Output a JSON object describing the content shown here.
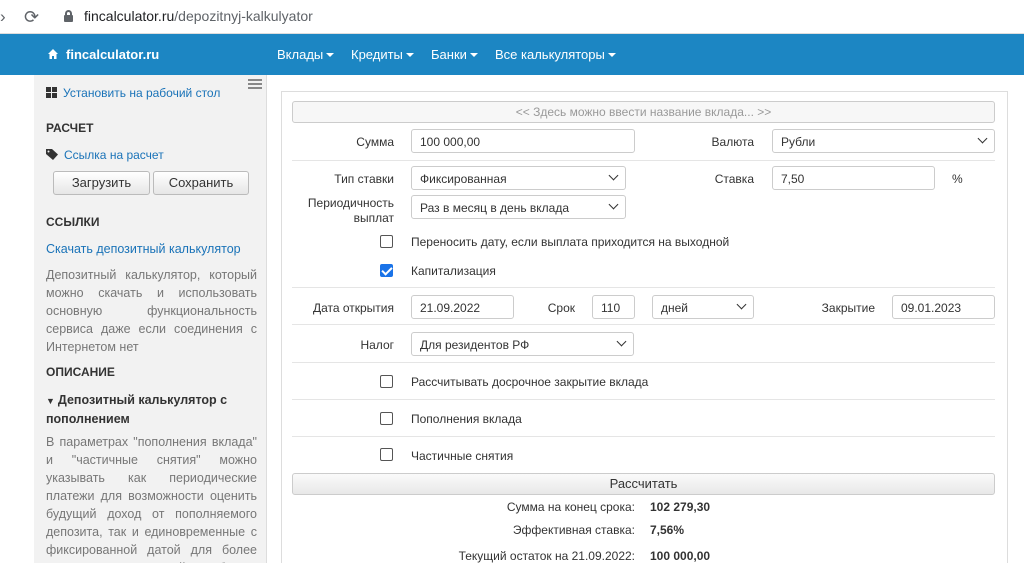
{
  "browser": {
    "url_host": "fincalculator.ru",
    "url_path": "/depozitnyj-kalkulyator"
  },
  "topnav": {
    "brand": "fincalculator.ru",
    "items": [
      {
        "label": "Вклады"
      },
      {
        "label": "Кредиты"
      },
      {
        "label": "Банки"
      },
      {
        "label": "Все калькуляторы"
      }
    ]
  },
  "sidebar": {
    "install": "Установить на рабочий стол",
    "section_calc": "РАСЧЕТ",
    "link_calc": "Ссылка на расчет",
    "btn_load": "Загрузить",
    "btn_save": "Сохранить",
    "section_links": "ССЫЛКИ",
    "download_link": "Скачать депозитный калькулятор",
    "download_desc": "Депозитный калькулятор, который можно скачать и использовать основную функциональность сервиса даже если соединения с Интернетом нет",
    "section_desc": "ОПИСАНИЕ",
    "desc_title": "Депозитный калькулятор с пополнением",
    "desc_text": "В параметрах \"пополнения вклада\" и \"частичные снятия\" можно указывать как периодические платежи для возможности оценить будущий доход от пополняемого депозита, так и единовременные с фиксированной датой для более точного учета движений на vкб"
  },
  "form": {
    "deposit_name_placeholder": "<< Здесь можно ввести название вклада... >>",
    "amount_label": "Сумма",
    "amount_value": "100 000,00",
    "currency_label": "Валюта",
    "currency_value": "Рубли",
    "rate_type_label": "Тип ставки",
    "rate_type_value": "Фиксированная",
    "rate_label": "Ставка",
    "rate_value": "7,50",
    "rate_unit": "%",
    "periodicity_label_1": "Периодичность",
    "periodicity_label_2": "выплат",
    "periodicity_value": "Раз в месяц в день вклада",
    "move_date_label": "Переносить дату, если выплата приходится на выходной",
    "move_date_checked": false,
    "capitalization_label": "Капитализация",
    "capitalization_checked": true,
    "open_date_label": "Дата открытия",
    "open_date_value": "21.09.2022",
    "term_label": "Срок",
    "term_value": "110",
    "term_unit": "дней",
    "close_label": "Закрытие",
    "close_value": "09.01.2023",
    "tax_label": "Налог",
    "tax_value": "Для резидентов РФ",
    "early_close_label": "Рассчитывать досрочное закрытие вклада",
    "early_close_checked": false,
    "replenish_label": "Пополнения вклада",
    "replenish_checked": false,
    "withdraw_label": "Частичные снятия",
    "withdraw_checked": false,
    "calc_button": "Рассчитать"
  },
  "results": [
    {
      "label": "Сумма на конец срока:",
      "value": "102 279,30"
    },
    {
      "label": "Эффективная ставка:",
      "value": "7,56%"
    },
    {
      "label": "Текущий остаток на 21.09.2022:",
      "value": "100 000,00"
    }
  ]
}
